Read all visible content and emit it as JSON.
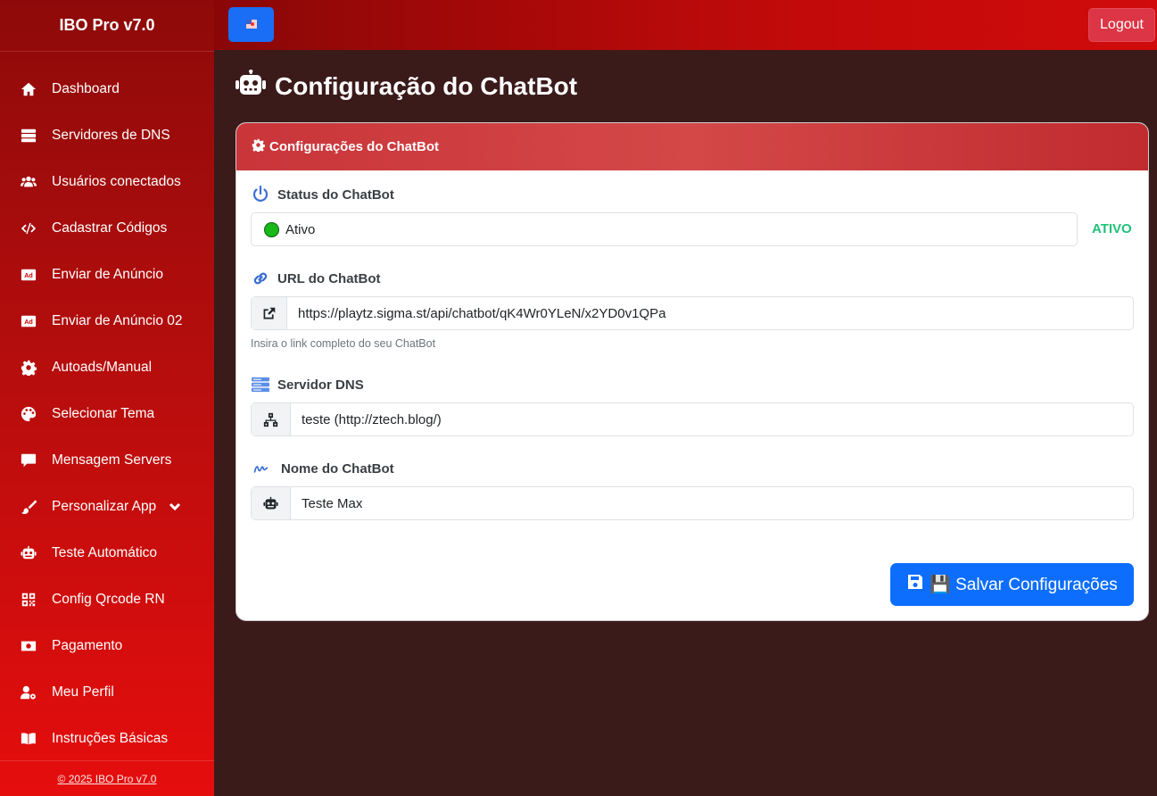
{
  "app": {
    "title": "IBO Pro v7.0"
  },
  "sidebar": {
    "items": [
      {
        "label": "Dashboard",
        "icon": "home-icon"
      },
      {
        "label": "Servidores de DNS",
        "icon": "server-icon"
      },
      {
        "label": "Usuários conectados",
        "icon": "users-icon"
      },
      {
        "label": "Cadastrar Códigos",
        "icon": "code-icon"
      },
      {
        "label": "Enviar de Anúncio",
        "icon": "ad-icon"
      },
      {
        "label": "Enviar de Anúncio 02",
        "icon": "ad-icon"
      },
      {
        "label": "Autoads/Manual",
        "icon": "cog-icon"
      },
      {
        "label": "Selecionar Tema",
        "icon": "palette-icon"
      },
      {
        "label": "Mensagem Servers",
        "icon": "comment-icon"
      },
      {
        "label": "Personalizar App",
        "icon": "brush-icon"
      },
      {
        "label": "Teste Automático",
        "icon": "robot-icon"
      },
      {
        "label": "Config Qrcode RN",
        "icon": "qrcode-icon"
      },
      {
        "label": "Pagamento",
        "icon": "money-icon"
      },
      {
        "label": "Meu Perfil",
        "icon": "user-cog-icon"
      },
      {
        "label": "Instruções Básicas",
        "icon": "book-icon"
      }
    ],
    "footer": "© 2025 IBO Pro v7.0"
  },
  "topbar": {
    "logout_label": "Logout"
  },
  "page": {
    "title": "Configuração do ChatBot"
  },
  "card": {
    "header": "Configurações do ChatBot",
    "status": {
      "label": "Status do ChatBot",
      "value": "Ativo",
      "badge": "ATIVO"
    },
    "url": {
      "label": "URL do ChatBot",
      "value": "https://playtz.sigma.st/api/chatbot/qK4Wr0YLeN/x2YD0v1QPa",
      "help": "Insira o link completo do seu ChatBot"
    },
    "dns": {
      "label": "Servidor DNS",
      "value": "teste (http://ztech.blog/)"
    },
    "name": {
      "label": "Nome do ChatBot",
      "value": "Teste Max"
    },
    "save_label": "💾 Salvar Configurações"
  },
  "colors": {
    "accent": "#0d6efd",
    "danger": "#dc3545",
    "success": "#20c278",
    "background": "#3b1a1a"
  }
}
